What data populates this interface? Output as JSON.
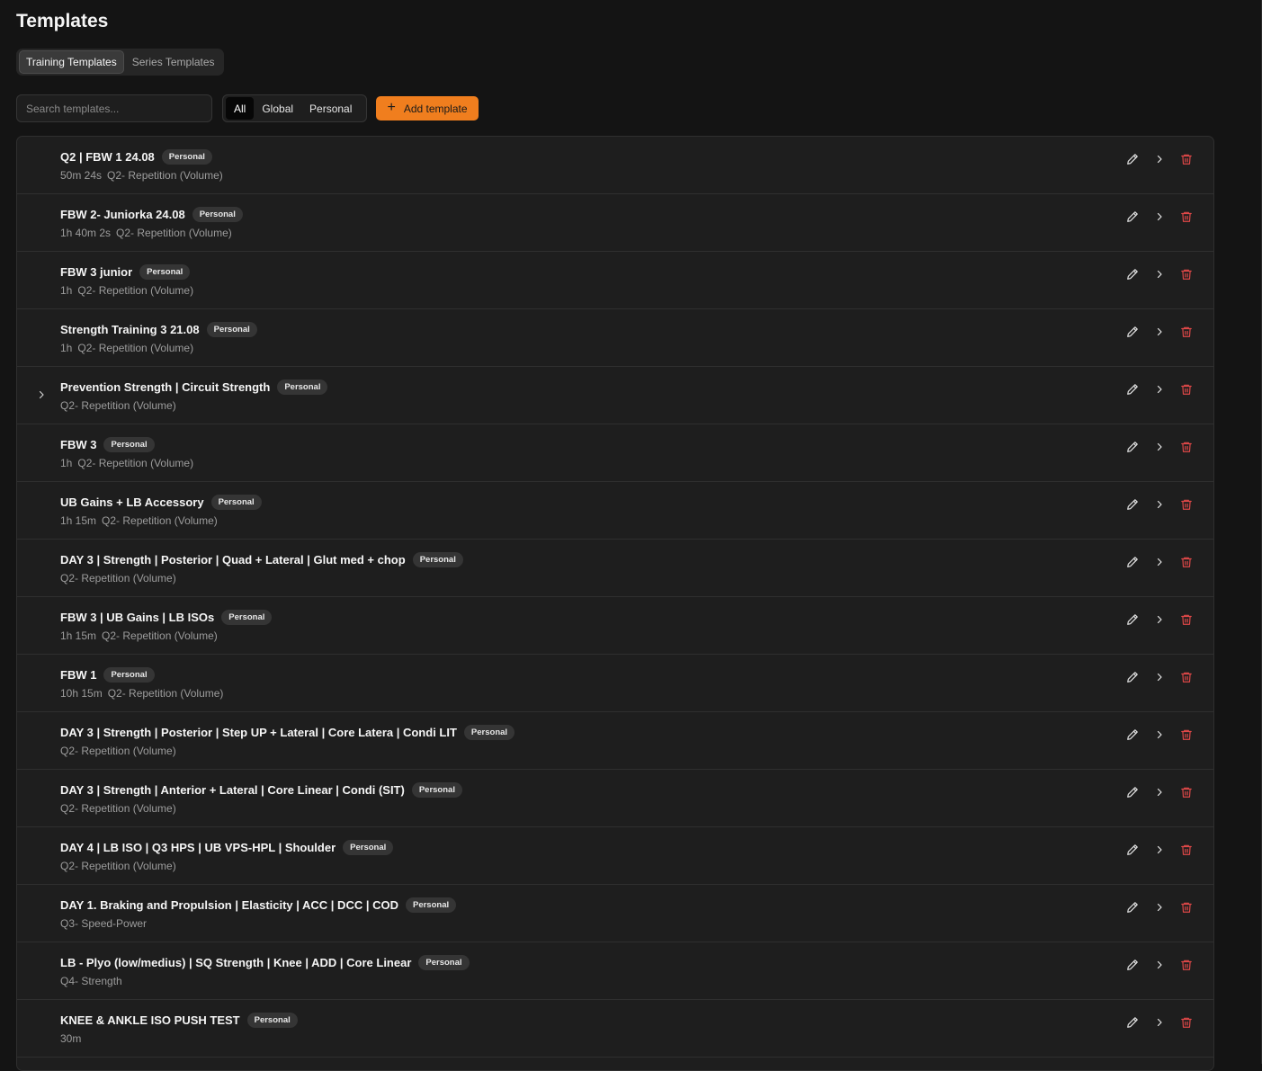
{
  "page": {
    "title": "Templates"
  },
  "tabs": [
    {
      "label": "Training Templates",
      "active": true
    },
    {
      "label": "Series Templates",
      "active": false
    }
  ],
  "search": {
    "placeholder": "Search templates..."
  },
  "filters": [
    {
      "label": "All",
      "active": true
    },
    {
      "label": "Global",
      "active": false
    },
    {
      "label": "Personal",
      "active": false
    }
  ],
  "add_button": {
    "label": "Add template"
  },
  "colors": {
    "accent": "#f07e1e",
    "delete": "#e04848",
    "background": "#141414"
  },
  "templates": [
    {
      "title": "Q2 | FBW 1 24.08",
      "badge": "Personal",
      "duration": "50m 24s",
      "category": "Q2- Repetition (Volume)",
      "expandable": false
    },
    {
      "title": "FBW 2- Juniorka 24.08",
      "badge": "Personal",
      "duration": "1h 40m 2s",
      "category": "Q2- Repetition (Volume)",
      "expandable": false
    },
    {
      "title": "FBW 3 junior",
      "badge": "Personal",
      "duration": "1h",
      "category": "Q2- Repetition (Volume)",
      "expandable": false
    },
    {
      "title": "Strength Training 3 21.08",
      "badge": "Personal",
      "duration": "1h",
      "category": "Q2- Repetition (Volume)",
      "expandable": false
    },
    {
      "title": "Prevention Strength | Circuit Strength",
      "badge": "Personal",
      "duration": "",
      "category": "Q2- Repetition (Volume)",
      "expandable": true
    },
    {
      "title": "FBW 3",
      "badge": "Personal",
      "duration": "1h",
      "category": "Q2- Repetition (Volume)",
      "expandable": false
    },
    {
      "title": "UB Gains + LB Accessory",
      "badge": "Personal",
      "duration": "1h 15m",
      "category": "Q2- Repetition (Volume)",
      "expandable": false
    },
    {
      "title": "DAY 3 | Strength | Posterior | Quad + Lateral | Glut med + chop",
      "badge": "Personal",
      "duration": "",
      "category": "Q2- Repetition (Volume)",
      "expandable": false
    },
    {
      "title": "FBW 3 | UB Gains | LB ISOs",
      "badge": "Personal",
      "duration": "1h 15m",
      "category": "Q2- Repetition (Volume)",
      "expandable": false
    },
    {
      "title": "FBW 1",
      "badge": "Personal",
      "duration": "10h 15m",
      "category": "Q2- Repetition (Volume)",
      "expandable": false
    },
    {
      "title": "DAY 3 | Strength | Posterior | Step UP + Lateral | Core Latera | Condi LIT",
      "badge": "Personal",
      "duration": "",
      "category": "Q2- Repetition (Volume)",
      "expandable": false
    },
    {
      "title": "DAY 3 | Strength | Anterior + Lateral | Core Linear | Condi (SIT)",
      "badge": "Personal",
      "duration": "",
      "category": "Q2- Repetition (Volume)",
      "expandable": false
    },
    {
      "title": "DAY 4 | LB ISO | Q3 HPS | UB VPS-HPL | Shoulder",
      "badge": "Personal",
      "duration": "",
      "category": "Q2- Repetition (Volume)",
      "expandable": false
    },
    {
      "title": "DAY 1. Braking and Propulsion | Elasticity | ACC | DCC | COD",
      "badge": "Personal",
      "duration": "",
      "category": "Q3- Speed-Power",
      "expandable": false
    },
    {
      "title": "LB - Plyo (low/medius) | SQ Strength | Knee | ADD | Core Linear",
      "badge": "Personal",
      "duration": "",
      "category": "Q4- Strength",
      "expandable": false
    },
    {
      "title": "KNEE & ANKLE ISO PUSH TEST",
      "badge": "Personal",
      "duration": "30m",
      "category": "",
      "expandable": false
    }
  ]
}
